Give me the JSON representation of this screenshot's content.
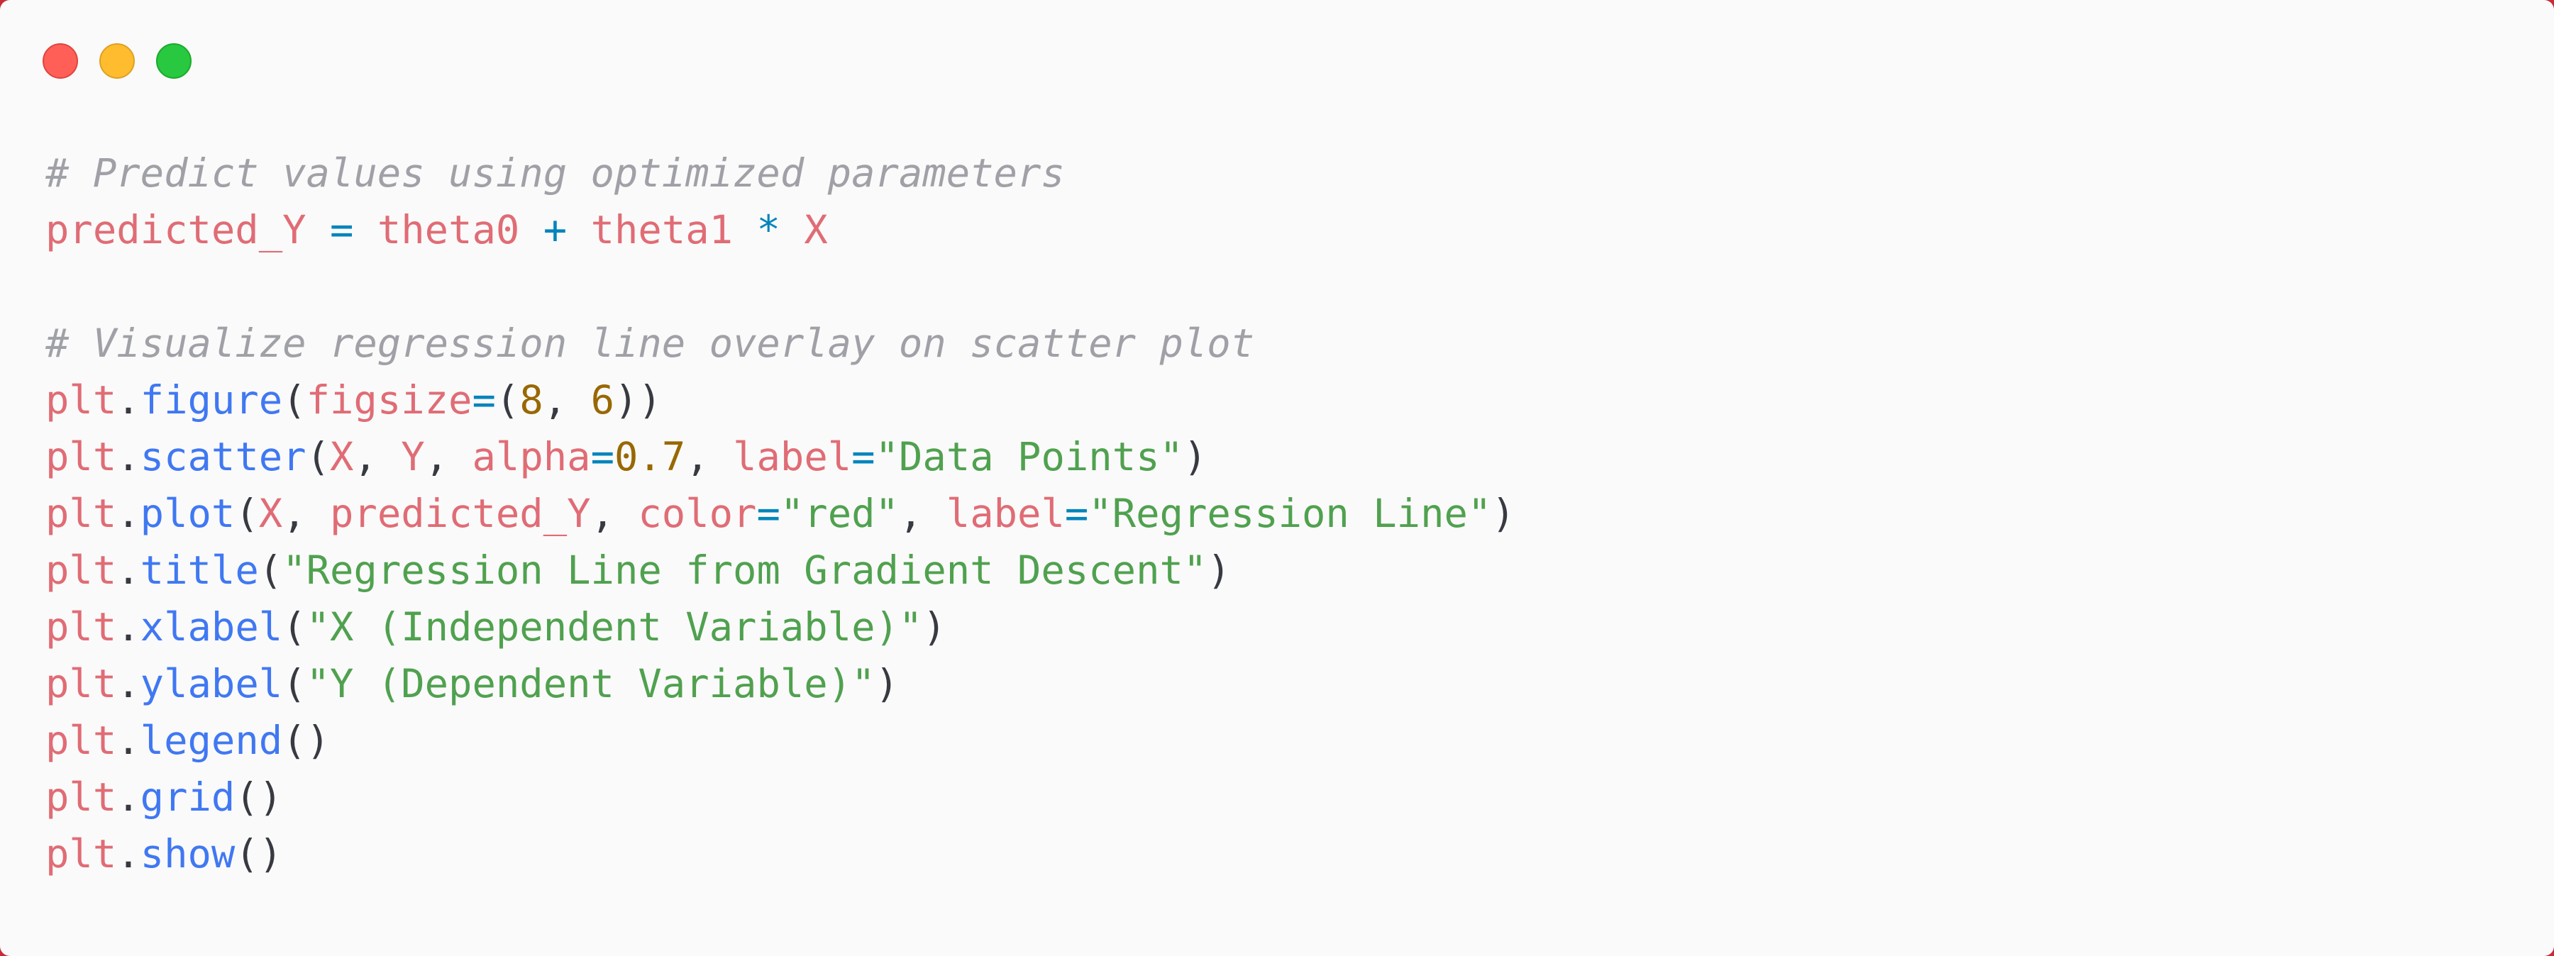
{
  "window": {
    "buttons": [
      "close",
      "minimize",
      "maximize"
    ]
  },
  "code": {
    "lines": [
      [
        {
          "t": "cm",
          "v": "# Predict values using optimized parameters"
        }
      ],
      [
        {
          "t": "var",
          "v": "predicted_Y"
        },
        {
          "t": "pl",
          "v": " "
        },
        {
          "t": "op",
          "v": "="
        },
        {
          "t": "pl",
          "v": " "
        },
        {
          "t": "var",
          "v": "theta0"
        },
        {
          "t": "pl",
          "v": " "
        },
        {
          "t": "op",
          "v": "+"
        },
        {
          "t": "pl",
          "v": " "
        },
        {
          "t": "var",
          "v": "theta1"
        },
        {
          "t": "pl",
          "v": " "
        },
        {
          "t": "op",
          "v": "*"
        },
        {
          "t": "pl",
          "v": " "
        },
        {
          "t": "var",
          "v": "X"
        }
      ],
      [],
      [
        {
          "t": "cm",
          "v": "# Visualize regression line overlay on scatter plot"
        }
      ],
      [
        {
          "t": "var",
          "v": "plt"
        },
        {
          "t": "pl",
          "v": "."
        },
        {
          "t": "fn",
          "v": "figure"
        },
        {
          "t": "pl",
          "v": "("
        },
        {
          "t": "var",
          "v": "figsize"
        },
        {
          "t": "op",
          "v": "="
        },
        {
          "t": "pl",
          "v": "("
        },
        {
          "t": "num",
          "v": "8"
        },
        {
          "t": "pl",
          "v": ", "
        },
        {
          "t": "num",
          "v": "6"
        },
        {
          "t": "pl",
          "v": "))"
        }
      ],
      [
        {
          "t": "var",
          "v": "plt"
        },
        {
          "t": "pl",
          "v": "."
        },
        {
          "t": "fn",
          "v": "scatter"
        },
        {
          "t": "pl",
          "v": "("
        },
        {
          "t": "var",
          "v": "X"
        },
        {
          "t": "pl",
          "v": ", "
        },
        {
          "t": "var",
          "v": "Y"
        },
        {
          "t": "pl",
          "v": ", "
        },
        {
          "t": "var",
          "v": "alpha"
        },
        {
          "t": "op",
          "v": "="
        },
        {
          "t": "num",
          "v": "0.7"
        },
        {
          "t": "pl",
          "v": ", "
        },
        {
          "t": "var",
          "v": "label"
        },
        {
          "t": "op",
          "v": "="
        },
        {
          "t": "str",
          "v": "\"Data Points\""
        },
        {
          "t": "pl",
          "v": ")"
        }
      ],
      [
        {
          "t": "var",
          "v": "plt"
        },
        {
          "t": "pl",
          "v": "."
        },
        {
          "t": "fn",
          "v": "plot"
        },
        {
          "t": "pl",
          "v": "("
        },
        {
          "t": "var",
          "v": "X"
        },
        {
          "t": "pl",
          "v": ", "
        },
        {
          "t": "var",
          "v": "predicted_Y"
        },
        {
          "t": "pl",
          "v": ", "
        },
        {
          "t": "var",
          "v": "color"
        },
        {
          "t": "op",
          "v": "="
        },
        {
          "t": "str",
          "v": "\"red\""
        },
        {
          "t": "pl",
          "v": ", "
        },
        {
          "t": "var",
          "v": "label"
        },
        {
          "t": "op",
          "v": "="
        },
        {
          "t": "str",
          "v": "\"Regression Line\""
        },
        {
          "t": "pl",
          "v": ")"
        }
      ],
      [
        {
          "t": "var",
          "v": "plt"
        },
        {
          "t": "pl",
          "v": "."
        },
        {
          "t": "fn",
          "v": "title"
        },
        {
          "t": "pl",
          "v": "("
        },
        {
          "t": "str",
          "v": "\"Regression Line from Gradient Descent\""
        },
        {
          "t": "pl",
          "v": ")"
        }
      ],
      [
        {
          "t": "var",
          "v": "plt"
        },
        {
          "t": "pl",
          "v": "."
        },
        {
          "t": "fn",
          "v": "xlabel"
        },
        {
          "t": "pl",
          "v": "("
        },
        {
          "t": "str",
          "v": "\"X (Independent Variable)\""
        },
        {
          "t": "pl",
          "v": ")"
        }
      ],
      [
        {
          "t": "var",
          "v": "plt"
        },
        {
          "t": "pl",
          "v": "."
        },
        {
          "t": "fn",
          "v": "ylabel"
        },
        {
          "t": "pl",
          "v": "("
        },
        {
          "t": "str",
          "v": "\"Y (Dependent Variable)\""
        },
        {
          "t": "pl",
          "v": ")"
        }
      ],
      [
        {
          "t": "var",
          "v": "plt"
        },
        {
          "t": "pl",
          "v": "."
        },
        {
          "t": "fn",
          "v": "legend"
        },
        {
          "t": "pl",
          "v": "()"
        }
      ],
      [
        {
          "t": "var",
          "v": "plt"
        },
        {
          "t": "pl",
          "v": "."
        },
        {
          "t": "fn",
          "v": "grid"
        },
        {
          "t": "pl",
          "v": "()"
        }
      ],
      [
        {
          "t": "var",
          "v": "plt"
        },
        {
          "t": "pl",
          "v": "."
        },
        {
          "t": "fn",
          "v": "show"
        },
        {
          "t": "pl",
          "v": "()"
        }
      ]
    ]
  },
  "colors": {
    "background": "#fafafa",
    "frame": "#c92a36",
    "comment": "#a0a1a7",
    "variable": "#e06c75",
    "operator": "#0184bc",
    "function": "#4078f2",
    "number": "#986801",
    "string": "#50a14f",
    "plain": "#383a42"
  }
}
